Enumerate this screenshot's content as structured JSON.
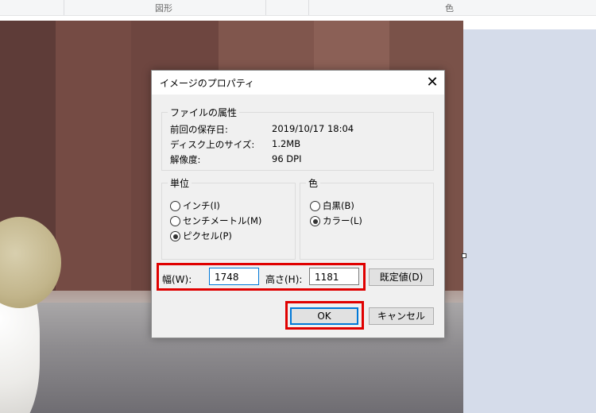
{
  "ribbon": {
    "group_shapes": "図形",
    "group_colors": "色"
  },
  "dialog": {
    "title": "イメージのプロパティ",
    "close_glyph": "✕",
    "file_attrs": {
      "legend": "ファイルの属性",
      "rows": [
        {
          "label": "前回の保存日:",
          "value": "2019/10/17 18:04"
        },
        {
          "label": "ディスク上のサイズ:",
          "value": "1.2MB"
        },
        {
          "label": "解像度:",
          "value": "96 DPI"
        }
      ]
    },
    "units": {
      "legend": "単位",
      "options": [
        {
          "label": "インチ(I)",
          "checked": false
        },
        {
          "label": "センチメートル(M)",
          "checked": false
        },
        {
          "label": "ピクセル(P)",
          "checked": true
        }
      ]
    },
    "color": {
      "legend": "色",
      "options": [
        {
          "label": "白黒(B)",
          "checked": false
        },
        {
          "label": "カラー(L)",
          "checked": true
        }
      ]
    },
    "width_label": "幅(W):",
    "width_value": "1748",
    "height_label": "高さ(H):",
    "height_value": "1181",
    "default_button": "既定値(D)",
    "ok_button": "OK",
    "cancel_button": "キャンセル"
  },
  "colors": {
    "highlight": "#e00000",
    "focus": "#0078d7",
    "dialog_bg": "#f0f0f0"
  }
}
